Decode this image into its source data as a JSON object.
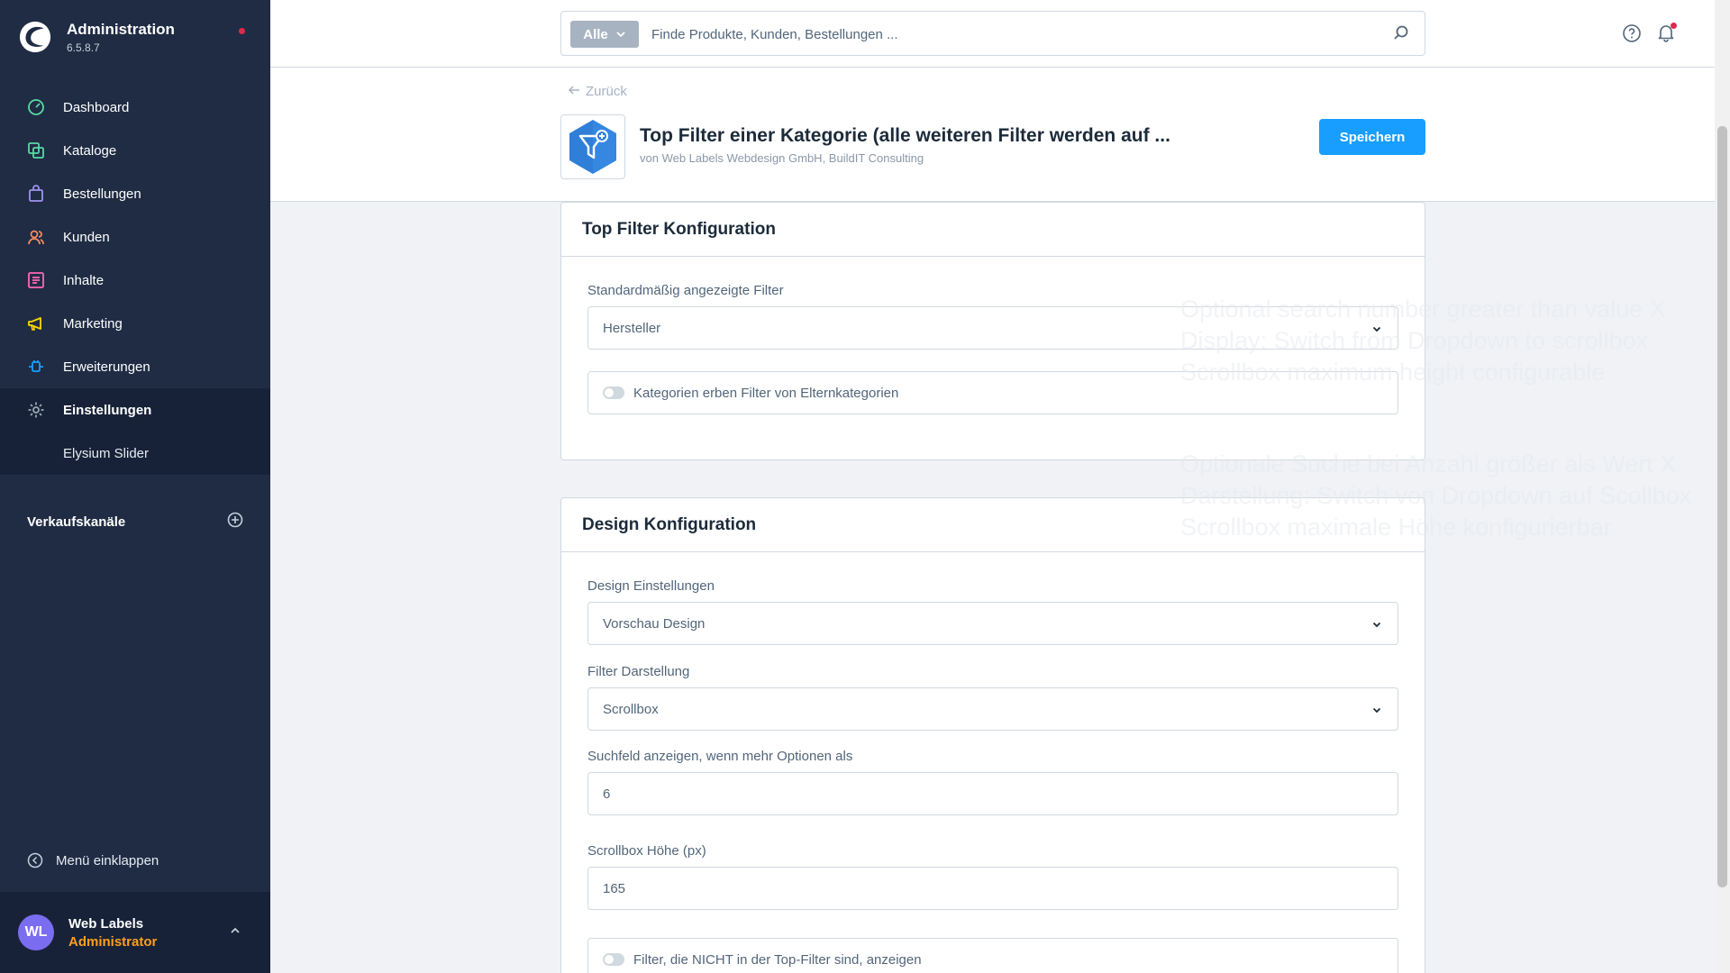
{
  "brand": {
    "title": "Administration",
    "version": "6.5.8.7"
  },
  "nav": {
    "items": [
      {
        "label": "Dashboard",
        "icon": "dashboard-icon",
        "color": "#57d9a3"
      },
      {
        "label": "Kataloge",
        "icon": "catalog-icon",
        "color": "#57d9a3"
      },
      {
        "label": "Bestellungen",
        "icon": "shopping-bag-icon",
        "color": "#a092f0"
      },
      {
        "label": "Kunden",
        "icon": "users-icon",
        "color": "#f88962"
      },
      {
        "label": "Inhalte",
        "icon": "content-icon",
        "color": "#ff68b4"
      },
      {
        "label": "Marketing",
        "icon": "megaphone-icon",
        "color": "#ffd700"
      },
      {
        "label": "Erweiterungen",
        "icon": "plug-icon",
        "color": "#189eff"
      },
      {
        "label": "Einstellungen",
        "icon": "gear-icon",
        "color": "#9aa8b5"
      }
    ],
    "sub_item": "Elysium Slider"
  },
  "sales_channels": {
    "label": "Verkaufskanäle"
  },
  "collapse_label": "Menü einklappen",
  "user": {
    "initials": "WL",
    "name": "Web Labels",
    "role": "Administrator"
  },
  "search": {
    "type_label": "Alle",
    "placeholder": "Finde Produkte, Kunden, Bestellungen ..."
  },
  "smartbar": {
    "back_label": "Zurück",
    "title": "Top Filter einer Kategorie (alle weiteren Filter werden auf ...",
    "subtitle": "von Web Labels Webdesign GmbH, BuildIT Consulting",
    "save_label": "Speichern"
  },
  "card1": {
    "title": "Top Filter Konfiguration",
    "default_filters_label": "Standardmäßig angezeigte Filter",
    "default_filters_value": "Hersteller",
    "inherit_label": "Kategorien erben Filter von Elternkategorien"
  },
  "card2": {
    "title": "Design Konfiguration",
    "design_label": "Design Einstellungen",
    "design_value": "Vorschau Design",
    "display_label": "Filter Darstellung",
    "display_value": "Scrollbox",
    "search_threshold_label": "Suchfeld anzeigen, wenn mehr Optionen als",
    "search_threshold_value": "6",
    "scrollbox_height_label": "Scrollbox Höhe (px)",
    "scrollbox_height_value": "165",
    "show_other_label": "Filter, die NICHT in der Top-Filter sind, anzeigen"
  },
  "ghost_text": {
    "en": [
      "Optional search number greater than value X",
      "Display: Switch from Dropdown to scrollbox",
      "Scrollbox maximum height configurable"
    ],
    "de": [
      "Optionale Suche bei Anzahl größer als Wert X",
      "Darstellung: Switch von Dropdown auf Scollbox",
      "Scrollbox maximale Höhe konfigurierbar"
    ]
  },
  "colors": {
    "accent": "#189eff",
    "sidebar": "#1f2c44",
    "role": "#ff9e1b",
    "notification": "#de294c",
    "avatar": "#7b6df0"
  }
}
